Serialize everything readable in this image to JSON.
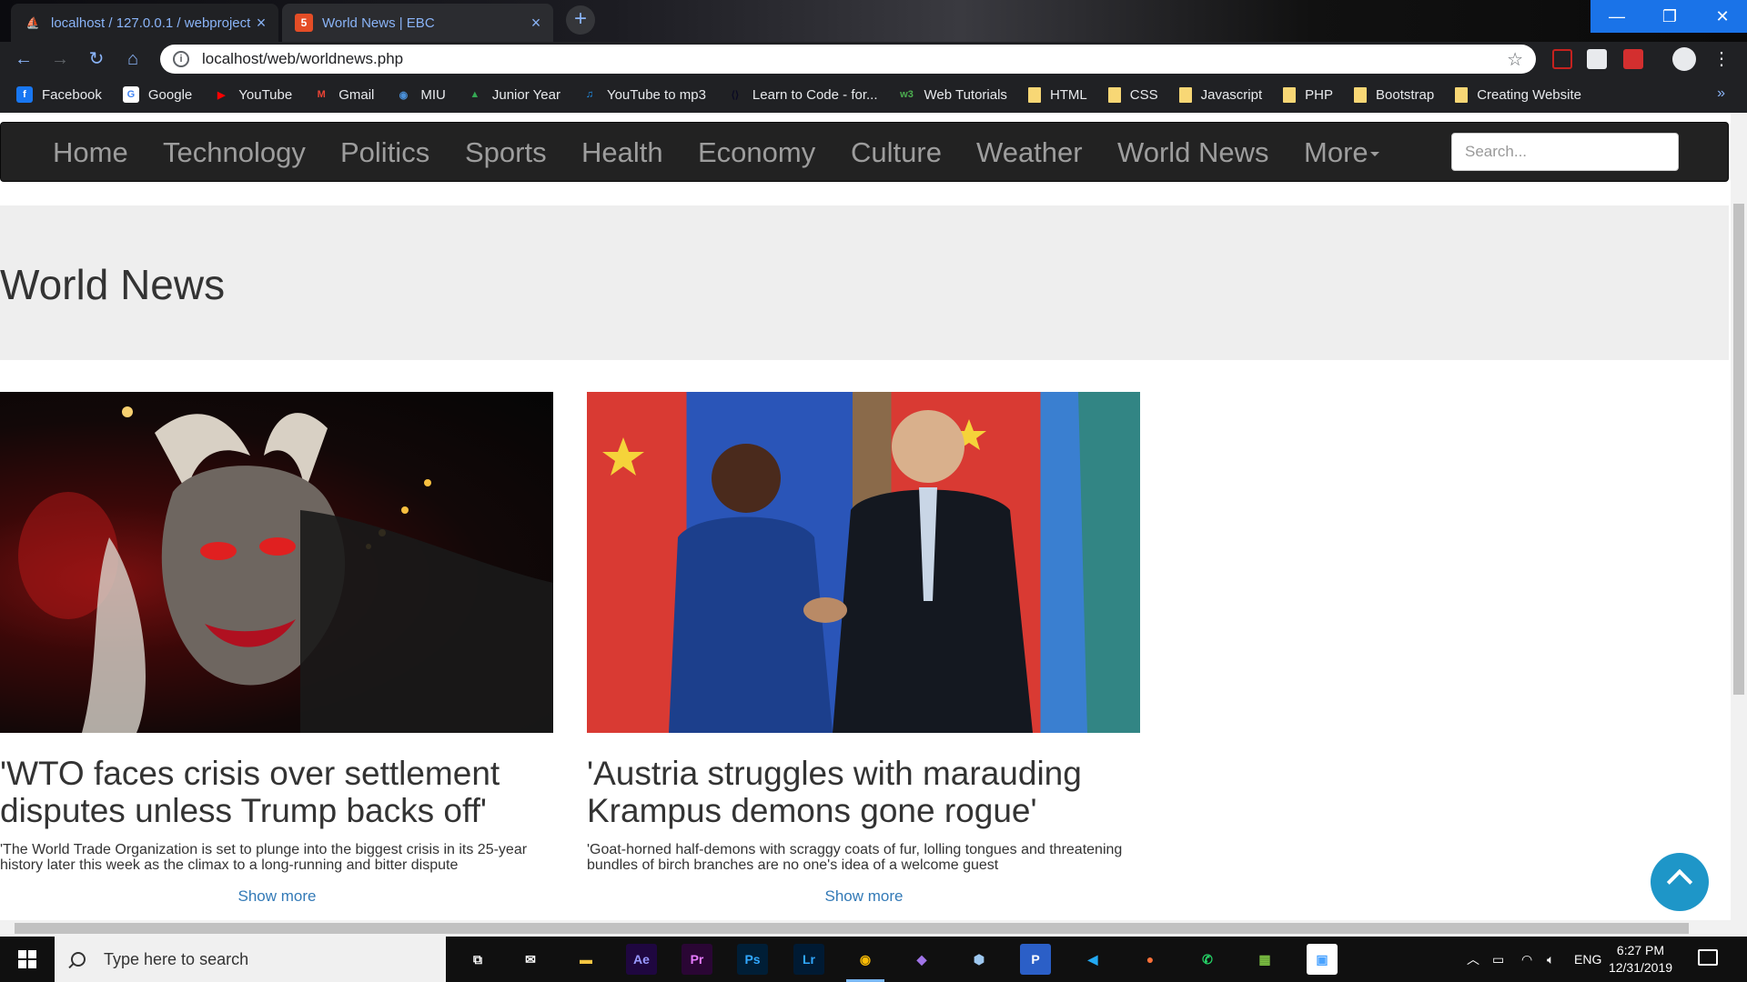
{
  "browser": {
    "tabs": [
      {
        "title": "localhost / 127.0.0.1 / webproject",
        "favicon": "phpmyadmin-icon"
      },
      {
        "title": "World News | EBC",
        "favicon": "html5-icon"
      }
    ],
    "new_tab_label": "+",
    "url": "localhost/web/worldnews.php",
    "bookmarks": [
      {
        "label": "Facebook",
        "icon": "facebook-icon",
        "color": "#1877f2",
        "glyph": "f"
      },
      {
        "label": "Google",
        "icon": "google-icon",
        "color": "#ffffff",
        "glyph": "G"
      },
      {
        "label": "YouTube",
        "icon": "youtube-icon",
        "color": "#ff0000",
        "glyph": "▶"
      },
      {
        "label": "Gmail",
        "icon": "gmail-icon",
        "color": "#ea4335",
        "glyph": "M"
      },
      {
        "label": "MIU",
        "icon": "globe-icon",
        "color": "#4a90d9",
        "glyph": "◉"
      },
      {
        "label": "Junior Year",
        "icon": "google-drive-icon",
        "color": "#34a853",
        "glyph": "▲"
      },
      {
        "label": "YouTube to mp3",
        "icon": "headphones-icon",
        "color": "#2196f3",
        "glyph": "♫"
      },
      {
        "label": "Learn to Code - for...",
        "icon": "freecodecamp-icon",
        "color": "#0a0a23",
        "glyph": "⟨⟩"
      },
      {
        "label": "Web Tutorials",
        "icon": "w3schools-icon",
        "color": "#4caf50",
        "glyph": "w3"
      },
      {
        "label": "HTML",
        "icon": "folder-icon"
      },
      {
        "label": "CSS",
        "icon": "folder-icon"
      },
      {
        "label": "Javascript",
        "icon": "folder-icon"
      },
      {
        "label": "PHP",
        "icon": "folder-icon"
      },
      {
        "label": "Bootstrap",
        "icon": "folder-icon"
      },
      {
        "label": "Creating Website",
        "icon": "folder-icon"
      }
    ],
    "bookmarks_overflow": "»"
  },
  "site": {
    "nav": [
      {
        "label": "Home"
      },
      {
        "label": "Technology"
      },
      {
        "label": "Politics"
      },
      {
        "label": "Sports"
      },
      {
        "label": "Health"
      },
      {
        "label": "Economy"
      },
      {
        "label": "Culture"
      },
      {
        "label": "Weather"
      },
      {
        "label": "World News"
      },
      {
        "label": "More"
      }
    ],
    "search_placeholder": "Search...",
    "page_title": "World News",
    "articles": [
      {
        "headline": "'WTO faces crisis over settlement disputes unless Trump backs off'",
        "summary": "'The World Trade Organization is set to plunge into the biggest crisis in its 25-year history later this week as the climax to a long-running and bitter dispute",
        "more_label": "Show more",
        "image": "krampus-photo"
      },
      {
        "headline": "'Austria struggles with marauding Krampus demons gone rogue'",
        "summary": "'Goat-horned half-demons with scraggy coats of fur, lolling tongues and threatening bundles of birch branches are no one's idea of a welcome guest",
        "more_label": "Show more",
        "image": "leaders-handshake-photo"
      }
    ],
    "colors": {
      "navbar": "#222222",
      "nav_text": "#9d9d9d",
      "jumbotron": "#eeeeee",
      "link": "#337ab7",
      "scroll_top_button": "#1e96c8"
    }
  },
  "taskbar": {
    "search_placeholder": "Type here to search",
    "pinned_apps": [
      {
        "name": "task-view-icon",
        "glyph": "⧉",
        "color": "#ffffff",
        "bg": "transparent"
      },
      {
        "name": "mail-icon",
        "glyph": "✉",
        "color": "#ffffff",
        "bg": "transparent"
      },
      {
        "name": "file-explorer-icon",
        "glyph": "▬",
        "color": "#f4c542",
        "bg": "transparent"
      },
      {
        "name": "after-effects-icon",
        "glyph": "Ae",
        "color": "#9999ff",
        "bg": "#1f0740"
      },
      {
        "name": "premiere-icon",
        "glyph": "Pr",
        "color": "#e77cff",
        "bg": "#2a0634"
      },
      {
        "name": "photoshop-icon",
        "glyph": "Ps",
        "color": "#31a8ff",
        "bg": "#001e36"
      },
      {
        "name": "lightroom-icon",
        "glyph": "Lr",
        "color": "#31a8ff",
        "bg": "#001a33"
      },
      {
        "name": "chrome-icon",
        "glyph": "◉",
        "color": "#fbbc05",
        "bg": "transparent",
        "active": true
      },
      {
        "name": "visual-studio-icon",
        "glyph": "◆",
        "color": "#a074e8",
        "bg": "transparent"
      },
      {
        "name": "3d-viewer-icon",
        "glyph": "⬢",
        "color": "#9ec8f0",
        "bg": "transparent"
      },
      {
        "name": "word-app-icon",
        "glyph": "P",
        "color": "#ffffff",
        "bg": "#2b5fc7"
      },
      {
        "name": "vscode-icon",
        "glyph": "◀",
        "color": "#23a9f2",
        "bg": "transparent"
      },
      {
        "name": "firefox-icon",
        "glyph": "●",
        "color": "#ff7139",
        "bg": "transparent"
      },
      {
        "name": "whatsapp-icon",
        "glyph": "✆",
        "color": "#25d366",
        "bg": "transparent"
      },
      {
        "name": "image-editor-icon",
        "glyph": "▦",
        "color": "#7cc242",
        "bg": "transparent"
      },
      {
        "name": "photos-icon",
        "glyph": "▣",
        "color": "#4aa3ff",
        "bg": "#ffffff"
      }
    ],
    "tray": {
      "language": "ENG",
      "time": "6:27 PM",
      "date": "12/31/2019"
    }
  }
}
